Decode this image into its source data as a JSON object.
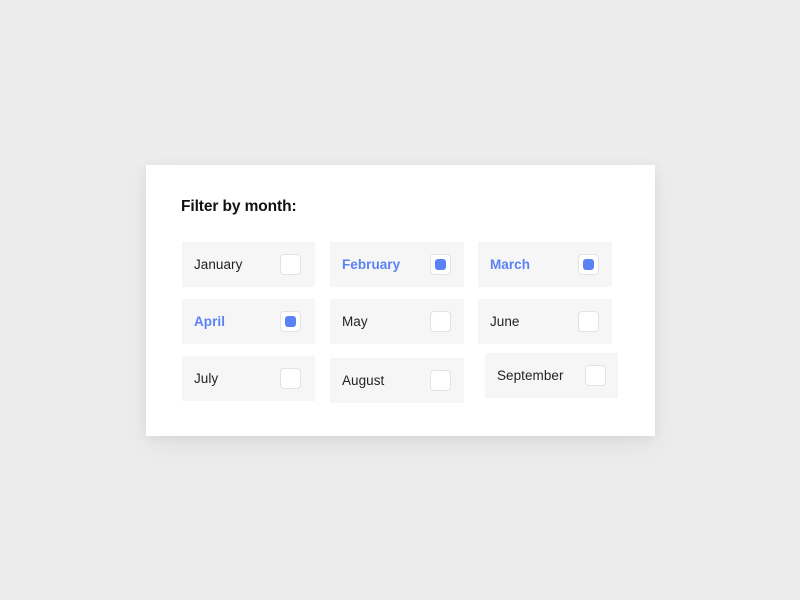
{
  "page": {
    "background_color": "#ececec"
  },
  "card": {
    "background_color": "#ffffff"
  },
  "panel": {
    "title": "Filter by month:",
    "accent_color": "#5b82f5",
    "chip_background": "#f6f6f7",
    "label_color": "#232326",
    "checkbox_border_color": "#e2e2e5",
    "checkbox_background": "#ffffff"
  },
  "months": [
    {
      "id": "january",
      "label": "January",
      "selected": false,
      "checkbox_state": "unchecked"
    },
    {
      "id": "february",
      "label": "February",
      "selected": true,
      "checkbox_state": "checked"
    },
    {
      "id": "march",
      "label": "March",
      "selected": true,
      "checkbox_state": "checked"
    },
    {
      "id": "april",
      "label": "April",
      "selected": true,
      "checkbox_state": "checked"
    },
    {
      "id": "may",
      "label": "May",
      "selected": false,
      "checkbox_state": "unchecked"
    },
    {
      "id": "june",
      "label": "June",
      "selected": false,
      "checkbox_state": "unchecked"
    },
    {
      "id": "july",
      "label": "July",
      "selected": false,
      "checkbox_state": "unchecked"
    },
    {
      "id": "august",
      "label": "August",
      "selected": false,
      "checkbox_state": "unchecked"
    },
    {
      "id": "september",
      "label": "September",
      "selected": false,
      "checkbox_state": "unchecked"
    }
  ]
}
